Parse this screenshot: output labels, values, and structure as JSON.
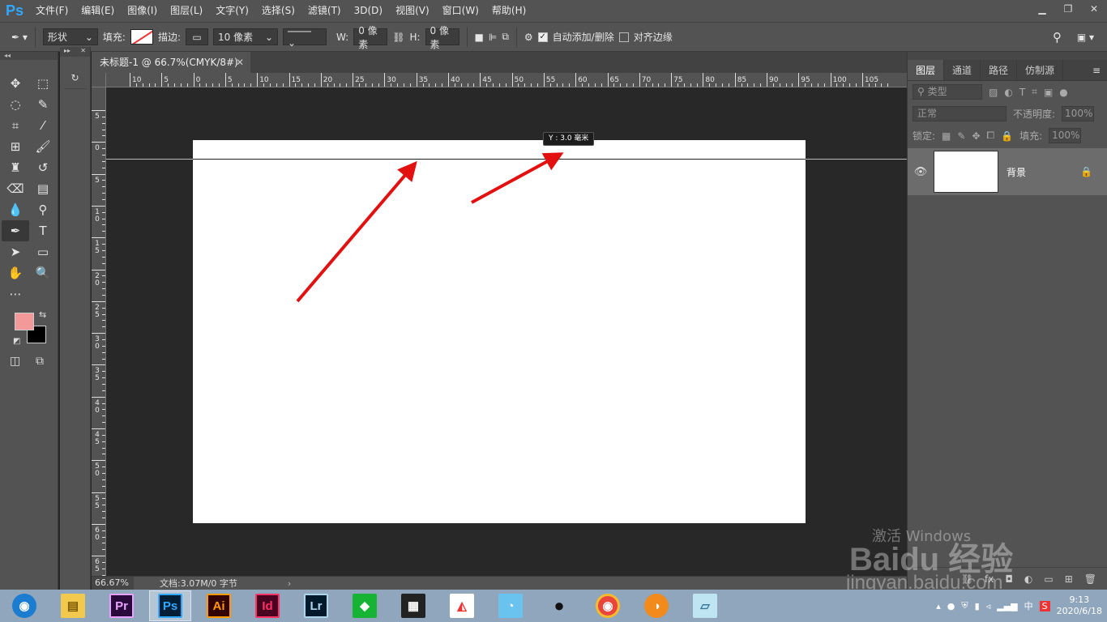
{
  "menubar": {
    "logo": "Ps",
    "items": [
      "文件(F)",
      "编辑(E)",
      "图像(I)",
      "图层(L)",
      "文字(Y)",
      "选择(S)",
      "滤镜(T)",
      "3D(D)",
      "视图(V)",
      "窗口(W)",
      "帮助(H)"
    ]
  },
  "options": {
    "mode": "形状",
    "fill_label": "填充:",
    "stroke_label": "描边:",
    "stroke_size": "10 像素",
    "w_label": "W:",
    "w_value": "0 像素",
    "h_label": "H:",
    "h_value": "0 像素",
    "auto_add_delete": "自动添加/删除",
    "align_edges": "对齐边缘"
  },
  "document": {
    "tab_title": "未标题-1 @ 66.7%(CMYK/8#)",
    "tooltip": "Y : 3.0 毫米"
  },
  "ruler": {
    "top_labels": [
      "10",
      "5",
      "0",
      "5",
      "10",
      "15",
      "20",
      "25",
      "30",
      "35",
      "40",
      "45",
      "50",
      "55",
      "60",
      "65",
      "70",
      "75",
      "80",
      "85",
      "90",
      "95",
      "100",
      "105"
    ],
    "left_labels": [
      "5",
      "0",
      "5",
      "10",
      "15",
      "20",
      "25",
      "30",
      "35",
      "40",
      "45",
      "50",
      "55",
      "60",
      "65"
    ]
  },
  "status": {
    "zoom": "66.67%",
    "doc_info": "文档:3.07M/0 字节"
  },
  "layers_panel": {
    "tabs": [
      "图层",
      "通道",
      "路径",
      "仿制源"
    ],
    "filter_kind": "类型",
    "blend_mode": "正常",
    "opacity_label": "不透明度:",
    "opacity_value": "100%",
    "lock_label": "锁定:",
    "fill_label": "填充:",
    "fill_value": "100%",
    "layers": [
      {
        "name": "背景"
      }
    ]
  },
  "watermark": {
    "activate": "激活 Windows",
    "brand": "Baidu 经验",
    "site": "jingyan.baidu.com"
  },
  "taskbar": {
    "apps": [
      {
        "name": "Pr",
        "bg": "#2a0a3d",
        "fg": "#e9a3ff"
      },
      {
        "name": "Ps",
        "bg": "#001e36",
        "fg": "#31a8ff"
      },
      {
        "name": "Ai",
        "bg": "#330000",
        "fg": "#ff9a00"
      },
      {
        "name": "Id",
        "bg": "#49021f",
        "fg": "#ff3366"
      },
      {
        "name": "Lr",
        "bg": "#001a2b",
        "fg": "#add5ec"
      }
    ],
    "ime": "中",
    "time": "9:13",
    "date": "2020/6/18"
  },
  "colors": {
    "foreground": "#f4999a",
    "background": "#000000",
    "accent": "#31a8ff"
  }
}
